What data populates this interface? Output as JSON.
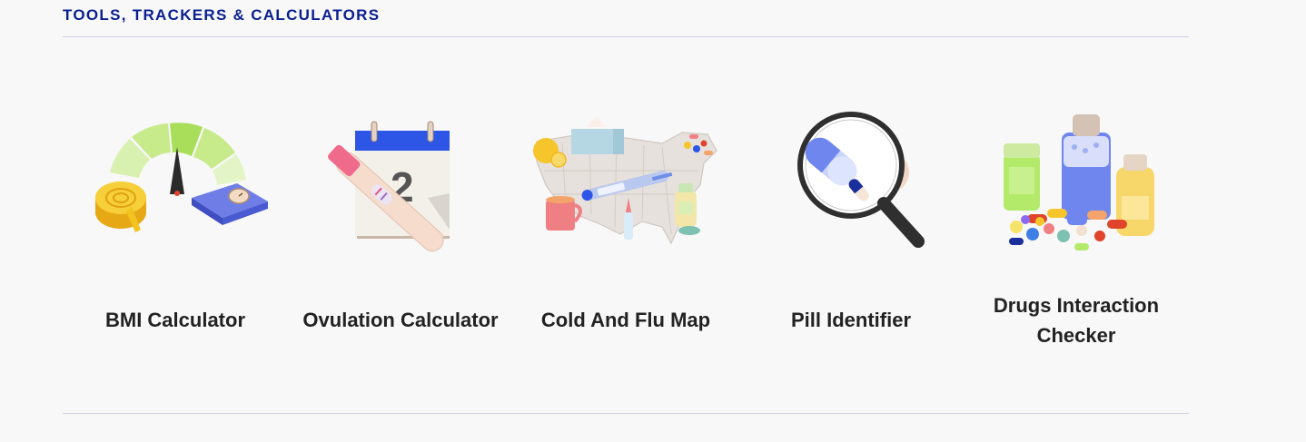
{
  "section": {
    "title": "TOOLS, TRACKERS & CALCULATORS"
  },
  "tools": [
    {
      "label": "BMI Calculator",
      "icon": "bmi-gauge-icon"
    },
    {
      "label": "Ovulation Calculator",
      "icon": "calendar-pregnancy-test-icon"
    },
    {
      "label": "Cold And Flu Map",
      "icon": "us-map-cold-flu-icon"
    },
    {
      "label": "Pill Identifier",
      "icon": "magnifier-pill-icon"
    },
    {
      "label": "Drugs Interaction Checker",
      "icon": "medicine-bottles-icon"
    }
  ],
  "colors": {
    "title": "#0a1f8f",
    "rule": "#cfd0e8",
    "label": "#222222",
    "background": "#f8f8f8"
  }
}
